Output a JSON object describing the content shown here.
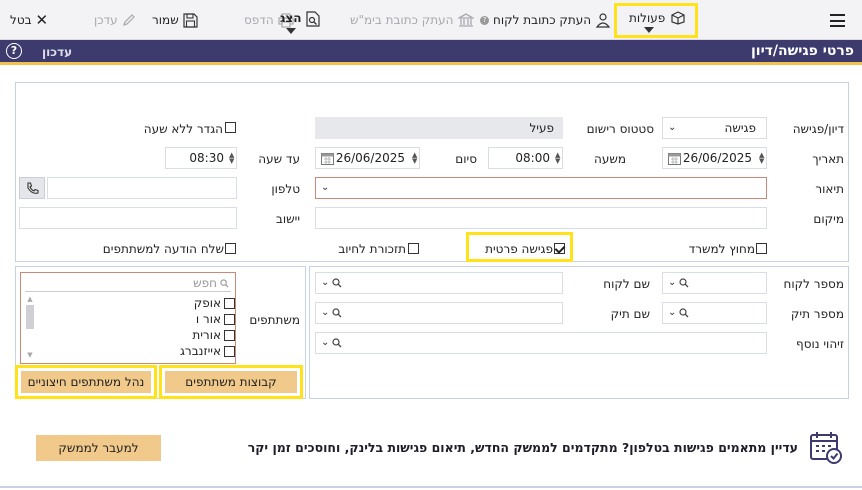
{
  "toolbar": {
    "menu_icon": "hamburger-icon",
    "actions_label": "פעולות",
    "copy_client_address_label": "העתק כתובת לקוח",
    "copy_court_address_label": "העתק כתובת בימ\"ש",
    "print_label": "הדפס",
    "show_label": "הצג",
    "save_label": "שמור",
    "update_label": "עדכן",
    "cancel_label": "בטל"
  },
  "titlebar": {
    "title": "פרטי פגישה/דיון",
    "update_label": "עדכון",
    "help_glyph": "?"
  },
  "form": {
    "type_label": "דיון/פגישה",
    "type_value": "פגישה",
    "status_label": "סטטוס רישום",
    "status_value": "פעיל",
    "all_day_label": "הגדר ללא שעה",
    "date_label": "תאריך",
    "date_value": "26/06/2025",
    "from_time_label": "משעה",
    "from_time_value": "08:00",
    "end_label": "סיום",
    "end_date_value": "26/06/2025",
    "to_time_label": "עד שעה",
    "to_time_value": "08:30",
    "description_label": "תיאור",
    "phone_label": "טלפון",
    "location_label": "מיקום",
    "settlement_label": "יישוב",
    "outside_office_label": "מחוץ למשרד",
    "private_meeting_label": "פגישה פרטית",
    "billing_reminder_label": "תזכורת לחיוב",
    "send_notification_label": "שלח הודעה למשתתפים"
  },
  "lower": {
    "client_number_label": "מספר לקוח",
    "client_name_label": "שם לקוח",
    "case_number_label": "מספר תיק",
    "case_name_label": "שם תיק",
    "extra_id_label": "זיהוי נוסף",
    "participants_label": "משתתפים",
    "search_placeholder": "חפש",
    "participants": [
      "אופק",
      "אור ו",
      "אורית",
      "אייזנברג"
    ],
    "participant_groups_button": "קבוצות משתתפים",
    "manage_external_button": "נהל משתתפים חיצוניים"
  },
  "promo": {
    "text": "עדיין מתאמים פגישות בטלפון? מתקדמים לממשק החדש, תיאום פגישות בלינק, וחוסכים זמן יקר",
    "button_label": "למעבר לממשק"
  },
  "colors": {
    "title_bar": "#3d3b6e",
    "title_underline": "#f2c14e",
    "highlight": "#ffe21a",
    "gold_button": "#f0c98b"
  }
}
